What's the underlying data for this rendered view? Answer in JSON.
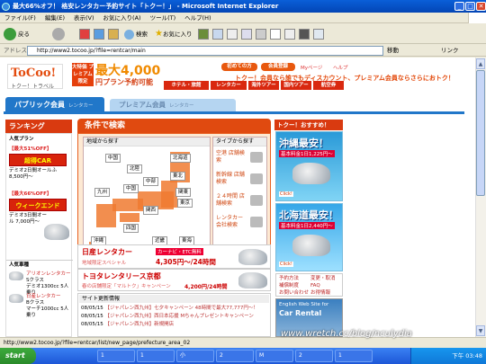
{
  "window": {
    "title": "最大66%オフ！ 格安レンタカー予約サイト「トクー！」 - Microsoft Internet Explorer"
  },
  "menu": [
    "ファイル(F)",
    "編集(E)",
    "表示(V)",
    "お気に入り(A)",
    "ツール(T)",
    "ヘルプ(H)"
  ],
  "toolbar": {
    "back": "戻る",
    "search": "検索",
    "favorites": "お気に入り"
  },
  "address": {
    "label": "アドレス(D)",
    "url": "http://www2.tocoo.jp/?file=rentcar/main",
    "go": "移動",
    "links": "リンク"
  },
  "site": {
    "logo": "ToCoo!",
    "logo_sub": "トクー！トラベル",
    "promo": "大特価 プレミアム 限定",
    "price": "最大4,000",
    "price_sub": "円プラン予約可能",
    "first_time": "初めての方",
    "register": "会員登録",
    "mypage": "Myページ",
    "help": "ヘルプ",
    "nav": [
      "ホテル・旅館",
      "レンタカー",
      "海外ツアー",
      "国内ツアー",
      "航空券"
    ],
    "slogan": "トクー！会員なら誰でもディスカウント、プレミアム会員ならさらにおトク！"
  },
  "tabs": {
    "public": "パブリック会員",
    "public_sub": "レンタカー",
    "premium": "プレミアム会員",
    "premium_sub": "レンタカー"
  },
  "ranking": {
    "title": "ランキング",
    "popular": "人気プラン",
    "offer1": "【最大51%OFF】",
    "plan1": "超得CAR",
    "desc1": "デミオ2日間オールふ 8,500円〜",
    "offer2": "【最大66%OFF】",
    "plan2": "ウィークエンド",
    "desc2": "デミオ3日間オール 7,000円〜",
    "vehicle": "人気車種",
    "car1": "アリオンレンタカー",
    "car1b": "Sクラス",
    "car1c": "デミオ1300cc 5人乗り",
    "car2": "日産レンタカー",
    "car2b": "Bクラス",
    "car2c": "マーチ1000cc 5人乗り"
  },
  "search": {
    "title": "条件で検索",
    "region_head": "地域から探す",
    "type_head": "タイプから探す",
    "regions": [
      "北海道",
      "東北",
      "関東",
      "東京",
      "中部",
      "北陸",
      "関西",
      "中国",
      "四国",
      "九州",
      "沖縄",
      "近畿",
      "東海"
    ],
    "types": [
      "空港 店舗検索",
      "新幹線 店舗検索",
      "２４時間 店舗検索",
      "レンタカー 会社検索"
    ]
  },
  "banners": {
    "nissan": "日産レンタカー",
    "nissan_tag": "カーナビ・ETC無料",
    "nissan_sub": "地域限定スペシャル",
    "nissan_price": "4,305円〜/24時間",
    "toyota": "トヨタレンタリース京都",
    "toyota_tag": "春の店舗限定「マルトク」キャンペーン",
    "toyota_price": "4,200円/24時間"
  },
  "news": {
    "title": "サイト更新情報",
    "items": [
      {
        "date": "08/05/15",
        "text": "【ジャパレン西九州】七夕キャンペーン 48時間で最大77,777円〜！"
      },
      {
        "date": "08/05/15",
        "text": "【ジャパレン西九州】西日本応援 Mちゃんプレゼントキャンペーン"
      },
      {
        "date": "08/05/15",
        "text": "【ジャパレン西九州】新規開店"
      }
    ]
  },
  "right": {
    "title": "トクー！おすすめ！",
    "okinawa": "沖縄最安！",
    "okinawa_sub": "基本料金1日1,225円〜",
    "hokkaido": "北海道最安！",
    "hokkaido_sub": "基本料金1日2,440円〜",
    "click": "Click!",
    "links": [
      "予約方法",
      "変更・取消",
      "補償制度",
      "FAQ",
      "お問い合わせ",
      "お得情報"
    ],
    "english1": "English Web Site for",
    "english2": "Car Rental"
  },
  "status": {
    "text": "http://www2.tocoo.jp/?file=rentcar/list/new_page/prefecture_area_02",
    "watermark": "www.wretch.cc/blog/nculydia"
  },
  "taskbar": {
    "start": "start",
    "tasks": [
      "1",
      "1",
      "小",
      "2",
      "M",
      "2",
      "1"
    ],
    "clock": "下午 03:48"
  }
}
